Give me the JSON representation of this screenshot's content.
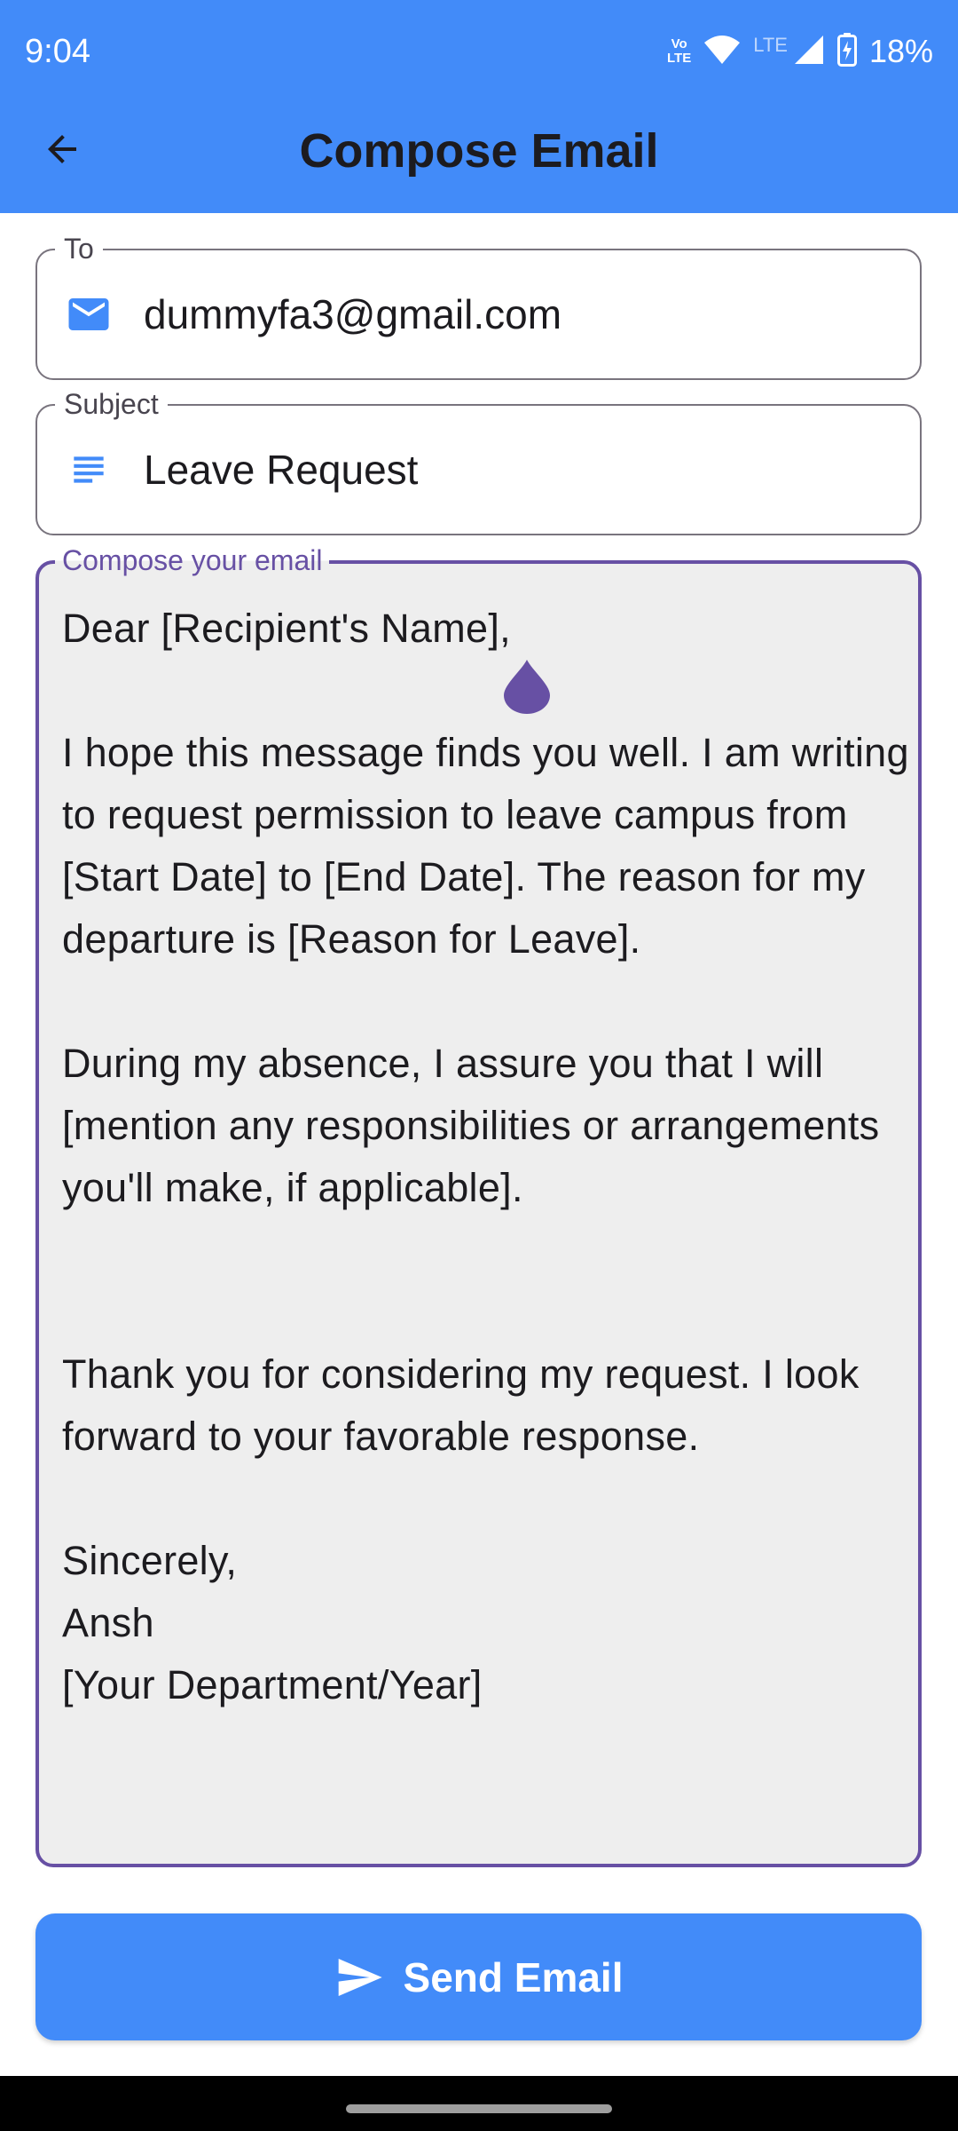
{
  "status_bar": {
    "time": "9:04",
    "volte_top": "Vo",
    "volte_bottom": "LTE",
    "network_label": "LTE",
    "battery": "18%",
    "icons": [
      "volte-icon",
      "wifi-icon",
      "signal-icon",
      "battery-charging-icon"
    ]
  },
  "app_bar": {
    "title": "Compose Email",
    "back_icon": "arrow-back-icon"
  },
  "form": {
    "to": {
      "label": "To",
      "value": "dummyfa3@gmail.com",
      "icon": "mail-icon"
    },
    "subject": {
      "label": "Subject",
      "value": "Leave Request",
      "icon": "subject-lines-icon"
    },
    "body": {
      "label": "Compose your email",
      "value": "Dear [Recipient's Name],\n\nI hope this message finds you well. I am writing to request permission to leave campus from [Start Date] to [End Date]. The reason for my departure is [Reason for Leave].\n\nDuring my absence, I assure you that I will [mention any responsibilities or arrangements you'll make, if applicable].\n\n\nThank you for considering my request. I look forward to your favorable response.\n\nSincerely,\nAnsh\n[Your Department/Year]"
    }
  },
  "send_button": {
    "label": "Send Email",
    "icon": "send-icon"
  },
  "colors": {
    "primary": "#428bf9",
    "accent": "#6750a4",
    "compose_bg": "#eeeeee",
    "outline": "#79747e",
    "nav_bar": "#000000"
  }
}
